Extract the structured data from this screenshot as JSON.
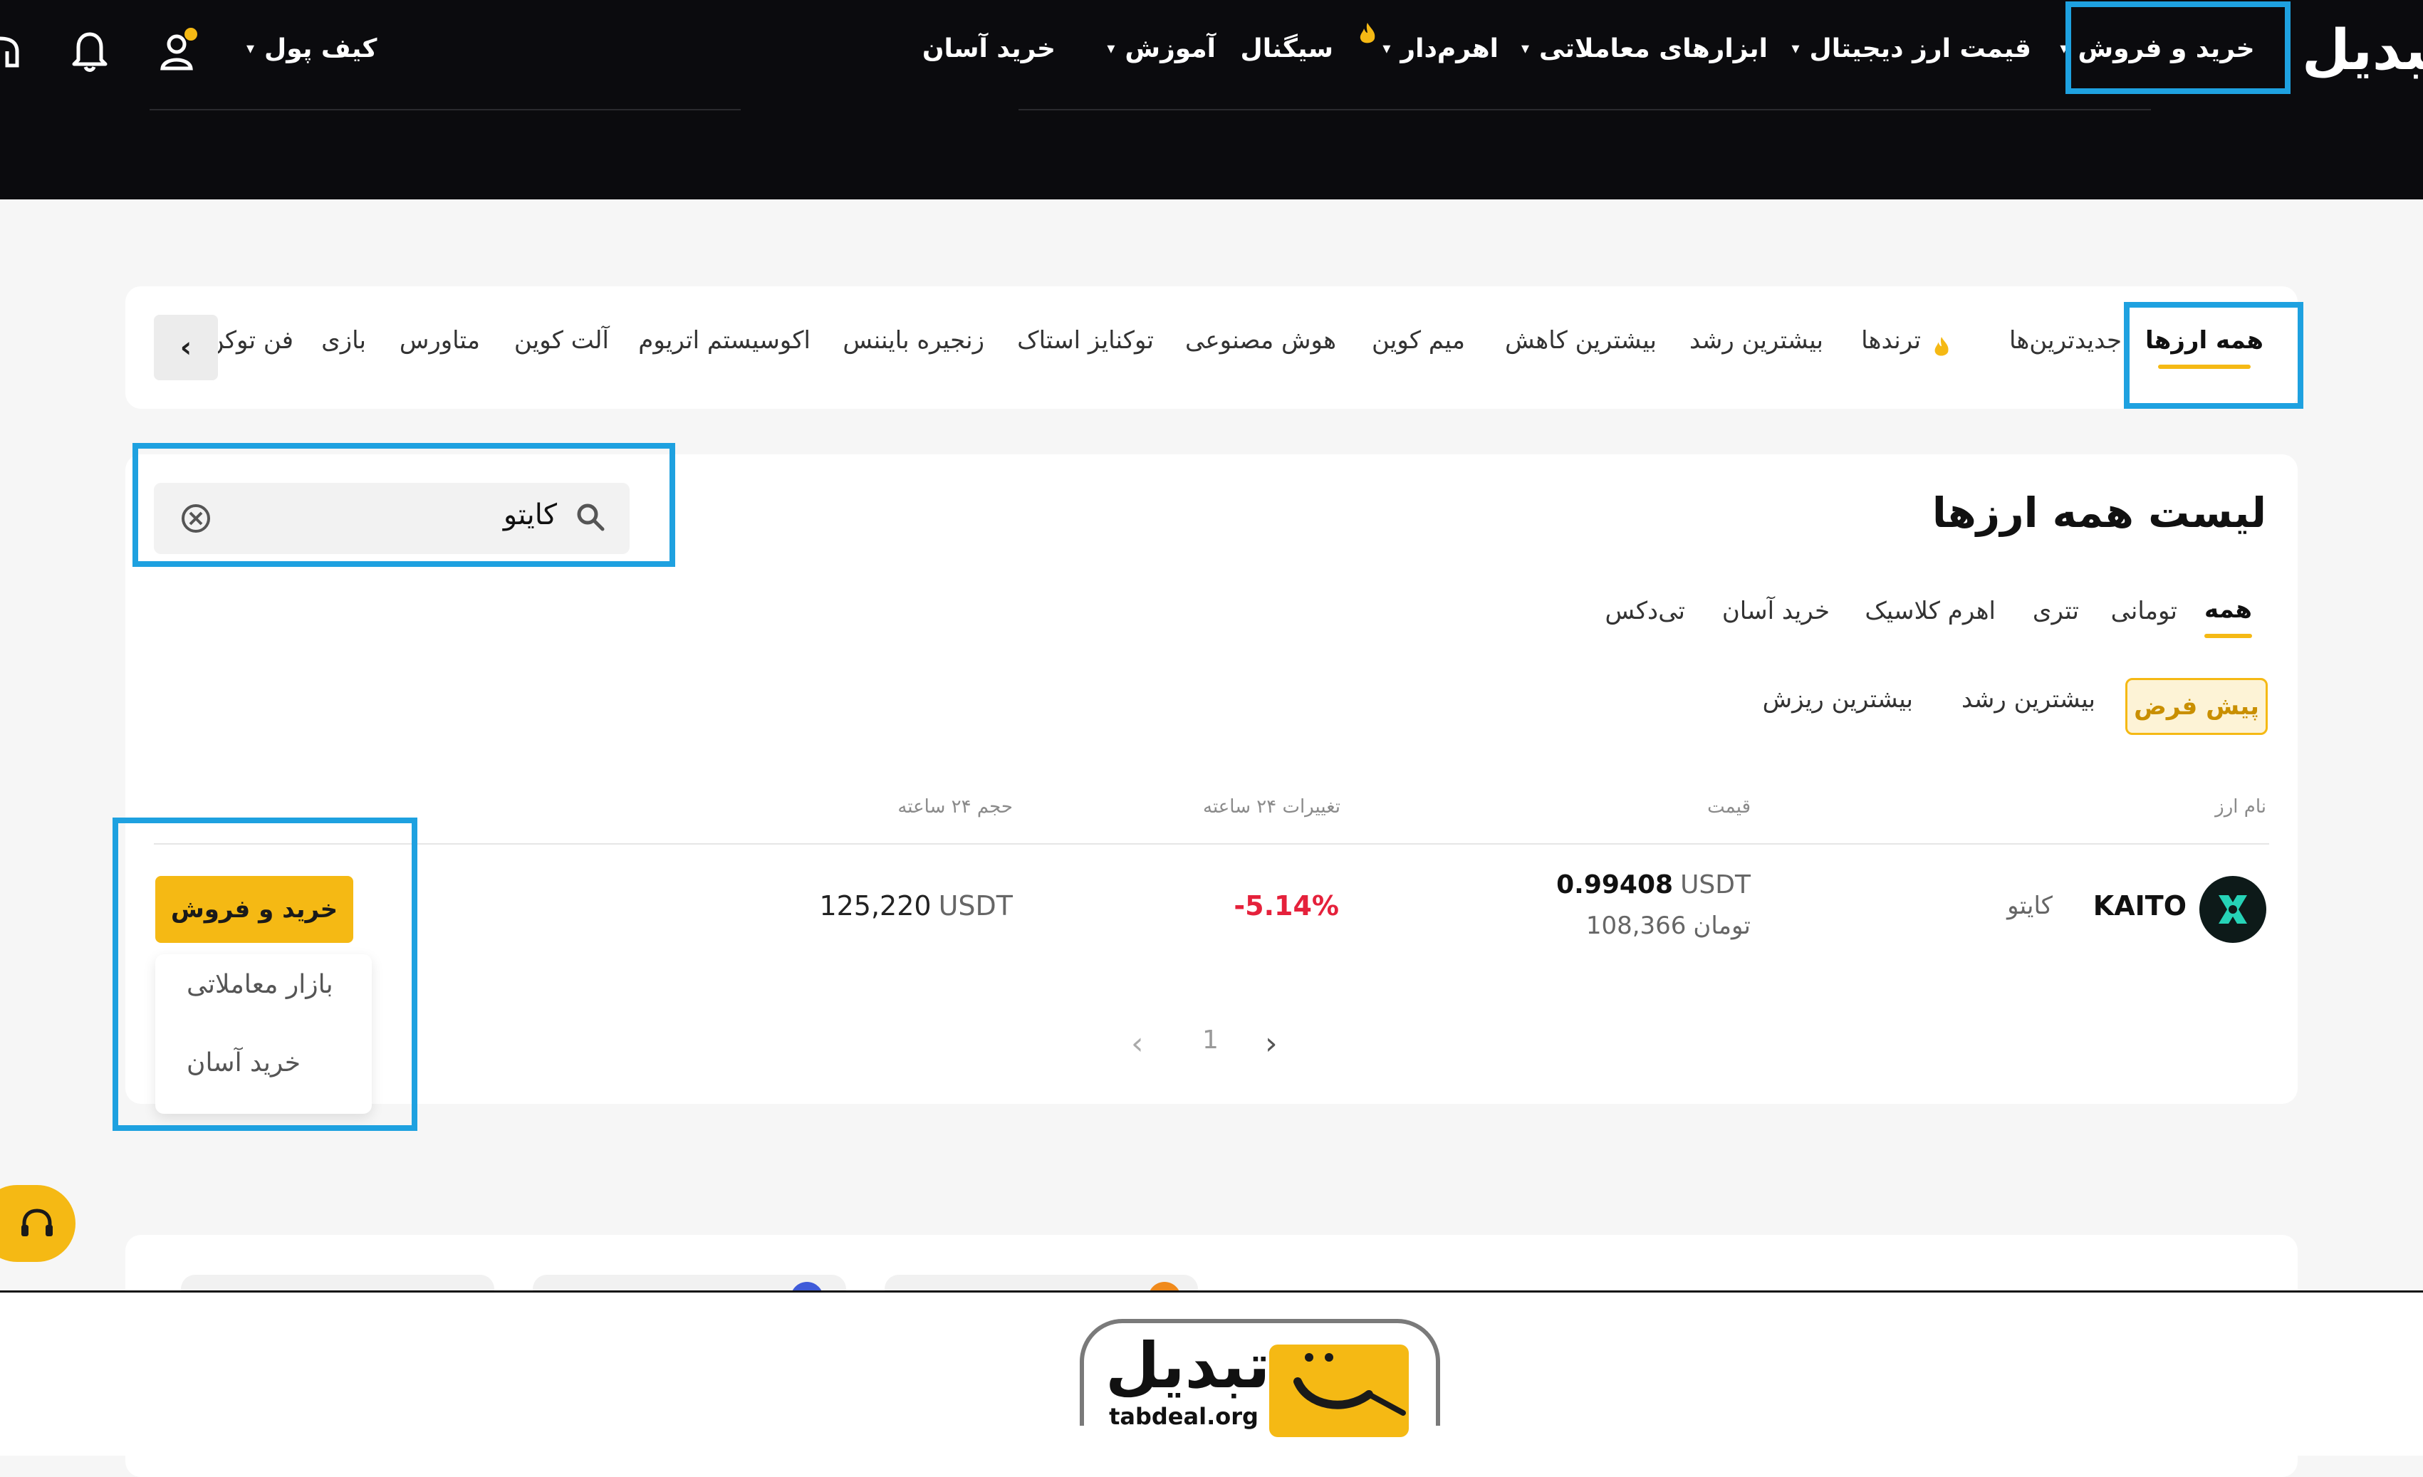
{
  "nav": {
    "logo": "تبدیل",
    "items": [
      "خرید و فروش",
      "قیمت ارز دیجیتال",
      "ابزارهای معاملاتی",
      "اهرم‌دار",
      "سیگنال",
      "آموزش",
      "خرید آسان"
    ],
    "wallet": "کیف پول"
  },
  "categories": [
    "همه ارزها",
    "جدیدترین‌ها",
    "ترندها",
    "بیشترین رشد",
    "بیشترین کاهش",
    "میم کوین",
    "هوش مصنوعی",
    "توکنایز استاک",
    "زنجیره بایننس",
    "اکوسیستم اتریوم",
    "آلت کوین",
    "متاورس",
    "بازی",
    "فن توکن"
  ],
  "search": {
    "value": "کایتو"
  },
  "list": {
    "title": "لیست همه ارزها",
    "tabs": [
      "همه",
      "تومانی",
      "تتری",
      "اهرم کلاسیک",
      "خرید آسان",
      "تی‌دکس"
    ],
    "sorts": [
      "پیش فرض",
      "بیشترین رشد",
      "بیشترین ریزش"
    ],
    "headers": {
      "name": "نام ارز",
      "price": "قیمت",
      "change": "تغییرات ۲۴ ساعته",
      "volume": "حجم ۲۴ ساعته"
    },
    "row": {
      "symbol": "KAITO",
      "name": "کایتو",
      "price_usdt": "0.99408",
      "usdt_unit": "USDT",
      "price_toman": "108,366",
      "toman_unit": "تومان",
      "change": "-5.14%",
      "volume": "125,220",
      "volume_unit": "USDT"
    },
    "actions": {
      "primary": "خرید و فروش",
      "market": "بازار معاملاتی",
      "easy": "خرید آسان"
    },
    "page": "1"
  },
  "footer": {
    "brand": "تبدیل",
    "domain": "tabdeal.org"
  },
  "colors": {
    "accent": "#f5b914",
    "highlight": "#1ea1e0",
    "negative": "#e5213b",
    "topbar": "#0b0b0e"
  }
}
